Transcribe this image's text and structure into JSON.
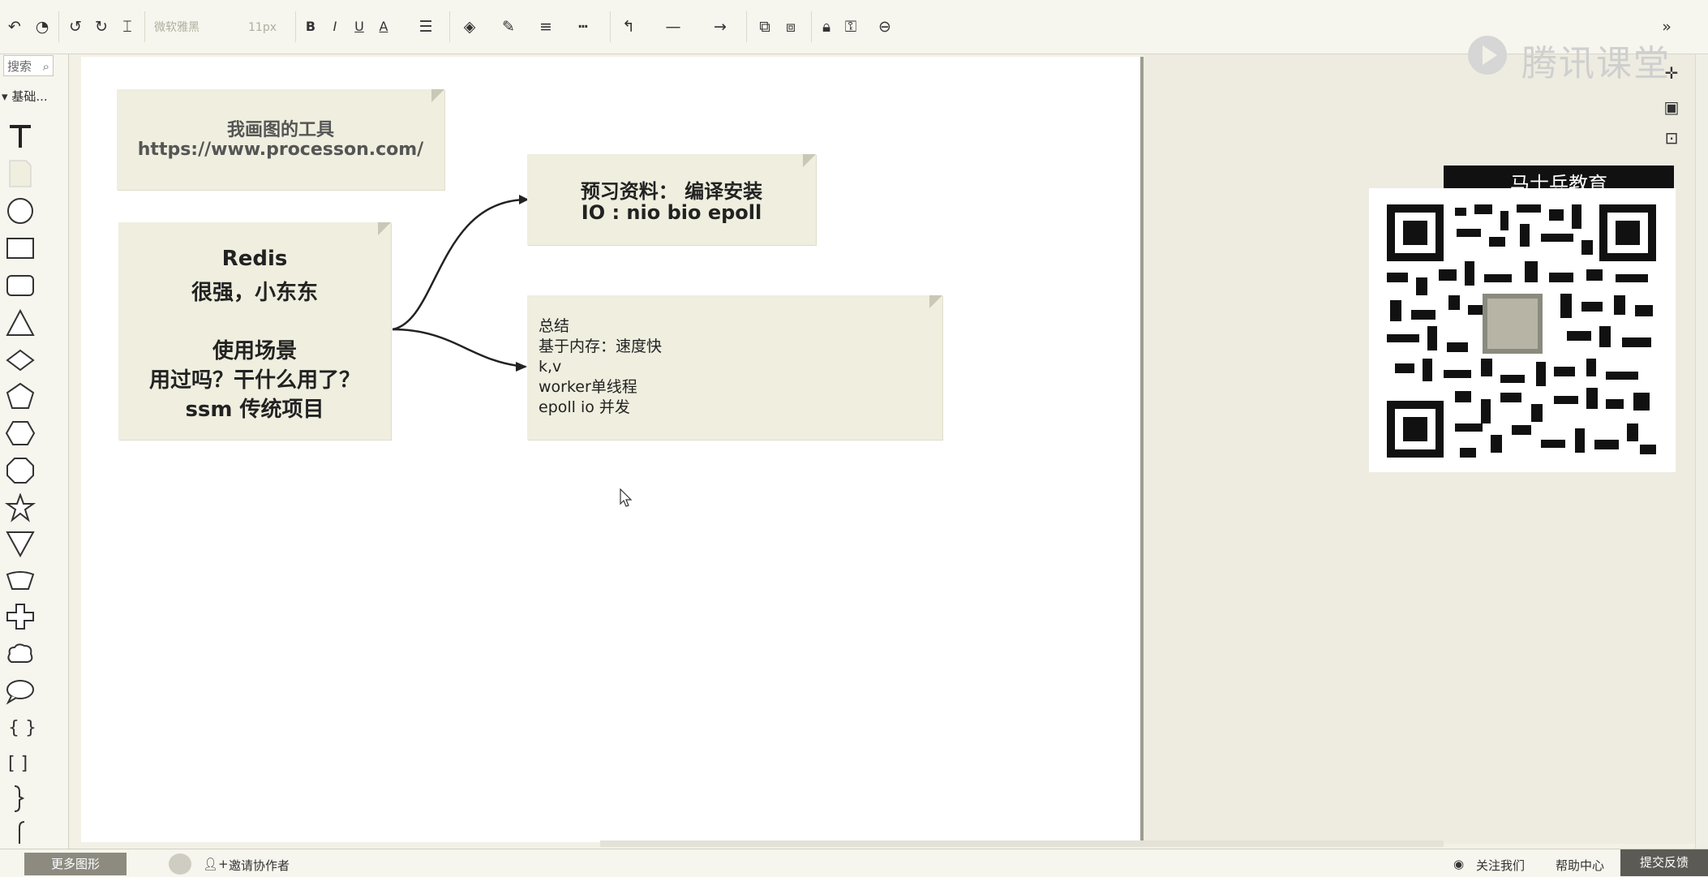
{
  "toolbar": {
    "font_name": "微软雅黑",
    "font_size": "11px",
    "bold": "B",
    "italic": "I",
    "underline": "U",
    "font_color": "A"
  },
  "left_panel": {
    "search_placeholder": "搜索",
    "category": "基础...",
    "more_shapes": "更多图形"
  },
  "notes": {
    "tool": {
      "line1": "我画图的工具",
      "line2": "https://www.processon.com/"
    },
    "redis": {
      "line1": "Redis",
      "line2": "很强，小东东",
      "line3": "使用场景",
      "line4": "用过吗？干什么用了？",
      "line5": "ssm  传统项目"
    },
    "prep": {
      "line1": "预习资料：   编译安装",
      "line2": "IO  :    nio bio  epoll"
    },
    "summary": {
      "line1": "总结",
      "line2": "基于内存：速度快",
      "line3": "k,v",
      "line4": "worker单线程",
      "line5": "epoll  io  并发"
    }
  },
  "overlay": {
    "watermark": "腾讯课堂",
    "brand": "马士兵教育"
  },
  "bottom_bar": {
    "invite": "邀请协作者",
    "follow": "关注我们",
    "help": "帮助中心",
    "feedback": "提交反馈"
  },
  "colors": {
    "note_bg": "#efeedf",
    "toolbar_bg": "#f6f5ee",
    "feedback_bg": "#5b5a55"
  }
}
